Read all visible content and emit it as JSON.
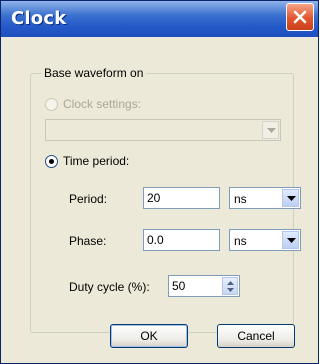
{
  "window": {
    "title": "Clock",
    "close_icon": "close-x-icon"
  },
  "group": {
    "legend": "Base waveform on"
  },
  "clock_settings": {
    "label": "Clock settings:",
    "value": "",
    "selected": false,
    "enabled": false
  },
  "time_period": {
    "label": "Time period:",
    "selected": true
  },
  "period": {
    "label": "Period:",
    "value": "20",
    "unit": "ns"
  },
  "phase": {
    "label": "Phase:",
    "value": "0.0",
    "unit": "ns"
  },
  "duty_cycle": {
    "label": "Duty cycle (%):",
    "value": "50"
  },
  "buttons": {
    "ok": "OK",
    "cancel": "Cancel"
  }
}
